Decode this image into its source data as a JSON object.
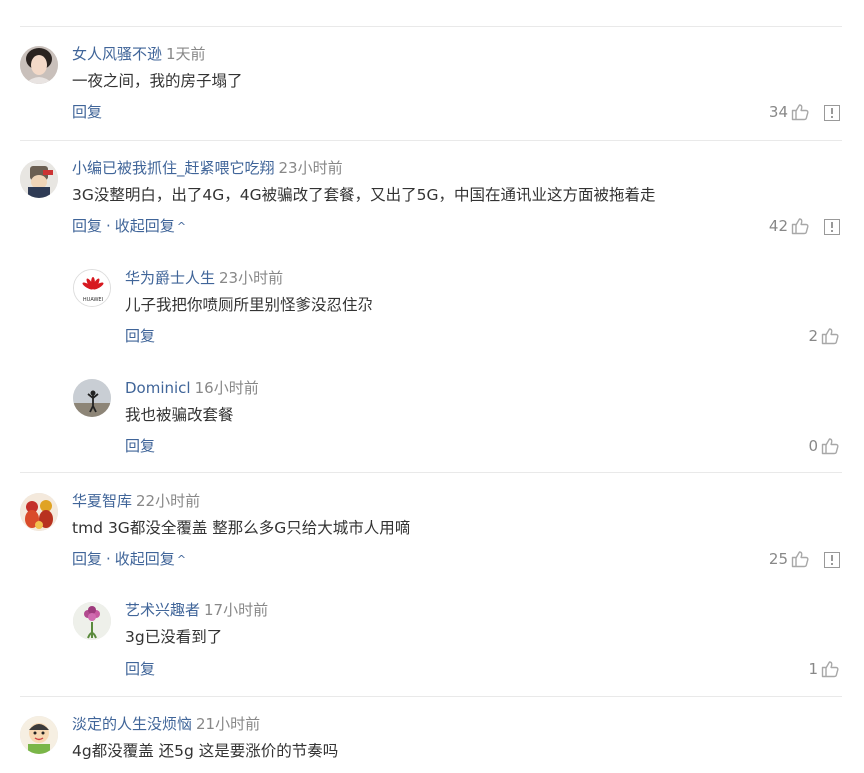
{
  "comments": [
    {
      "user": "女人风骚不逊",
      "time": "1天前",
      "text": "一夜之间，我的房子塌了",
      "reply_label": "回复",
      "likes": "34",
      "avatar_icon": "woman-portrait-icon"
    },
    {
      "user": "小编已被我抓住_赶紧喂它吃翔",
      "time": "23小时前",
      "text": "3G没整明白，出了4G，4G被骗改了套餐，又出了5G，中国在通讯业这方面被拖着走",
      "reply_label": "回复",
      "collapse_label": "收起回复",
      "likes": "42",
      "avatar_icon": "cartoon-character-icon",
      "replies": [
        {
          "user": "华为爵士人生",
          "time": "23小时前",
          "text": "儿子我把你喷厕所里别怪爹没忍住尕",
          "reply_label": "回复",
          "likes": "2",
          "avatar_icon": "huawei-logo-icon",
          "avatar_caption": "HUAWEI"
        },
        {
          "user": "Dominicl",
          "time": "16小时前",
          "text": "我也被骗改套餐",
          "reply_label": "回复",
          "likes": "0",
          "avatar_icon": "person-silhouette-icon"
        }
      ]
    },
    {
      "user": "华夏智库",
      "time": "22小时前",
      "text": "tmd 3G都没全覆盖 整那么多G只给大城市人用嘀",
      "reply_label": "回复",
      "collapse_label": "收起回复",
      "likes": "25",
      "avatar_icon": "festive-figures-icon",
      "replies": [
        {
          "user": "艺术兴趣者",
          "time": "17小时前",
          "text": "3g已没看到了",
          "reply_label": "回复",
          "likes": "1",
          "avatar_icon": "flower-icon"
        }
      ]
    },
    {
      "user": "淡定的人生没烦恼",
      "time": "21小时前",
      "text": "4g都没覆盖 还5g 这是要涨价的节奏吗",
      "avatar_icon": "cartoon-kid-icon"
    }
  ],
  "colors": {
    "username": "#406599",
    "timestamp": "#888888",
    "text": "#333333",
    "link": "#406599",
    "divider": "#e9e9e9"
  }
}
